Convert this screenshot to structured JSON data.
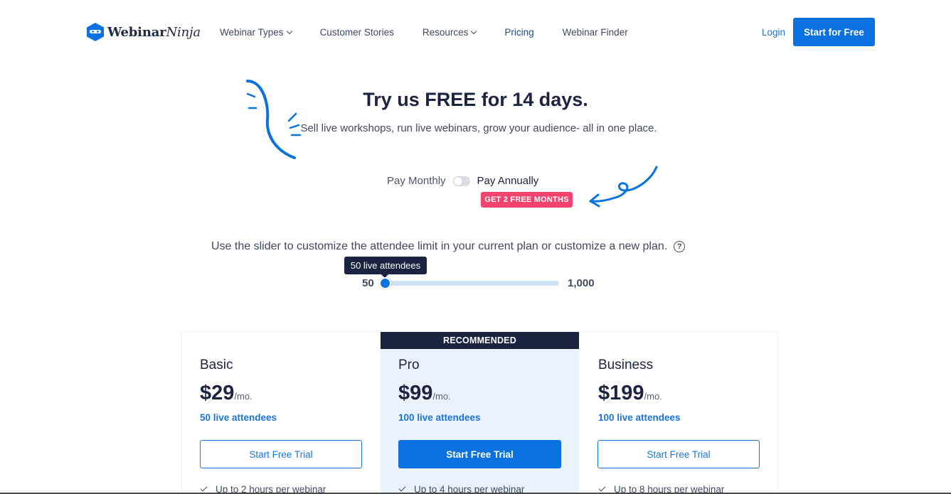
{
  "header": {
    "logo": {
      "brand": "Webinar",
      "brand_italic": "Ninja",
      "icon": "ninja-hexagon-icon",
      "color": "#0a72e0"
    },
    "nav": [
      {
        "label": "Webinar Types",
        "dropdown": true
      },
      {
        "label": "Customer Stories",
        "dropdown": false
      },
      {
        "label": "Resources",
        "dropdown": true
      },
      {
        "label": "Pricing",
        "dropdown": false,
        "active": true
      },
      {
        "label": "Webinar Finder",
        "dropdown": false
      }
    ],
    "login_label": "Login",
    "cta_label": "Start for Free"
  },
  "hero": {
    "title": "Try us FREE for 14 days.",
    "subtitle": "Sell live workshops, run live webinars, grow your audience- all in one place."
  },
  "billing": {
    "monthly_label": "Pay Monthly",
    "annual_label": "Pay Annually",
    "annual_selected": false,
    "badge": "GET 2 FREE MONTHS"
  },
  "slider": {
    "label": "Use the slider to customize the attendee limit in your current plan or customize a new plan.",
    "tooltip": "50 live attendees",
    "min_label": "50",
    "max_label": "1,000",
    "value": 50
  },
  "plans": {
    "recommended_label": "RECOMMENDED",
    "items": [
      {
        "name": "Basic",
        "price": "$29",
        "per": "/mo.",
        "attendees": "50 live attendees",
        "button": "Start Free Trial",
        "feature": "Up to 2 hours per webinar"
      },
      {
        "name": "Pro",
        "price": "$99",
        "per": "/mo.",
        "attendees": "100 live attendees",
        "button": "Start Free Trial",
        "feature": "Up to 4 hours per webinar"
      },
      {
        "name": "Business",
        "price": "$199",
        "per": "/mo.",
        "attendees": "100 live attendees",
        "button": "Start Free Trial",
        "feature": "Up to 8 hours per webinar"
      }
    ]
  },
  "colors": {
    "accent": "#0a72e0",
    "navy": "#1a2340",
    "badge": "#f4436e",
    "pro_bg": "#eaf3fd"
  }
}
